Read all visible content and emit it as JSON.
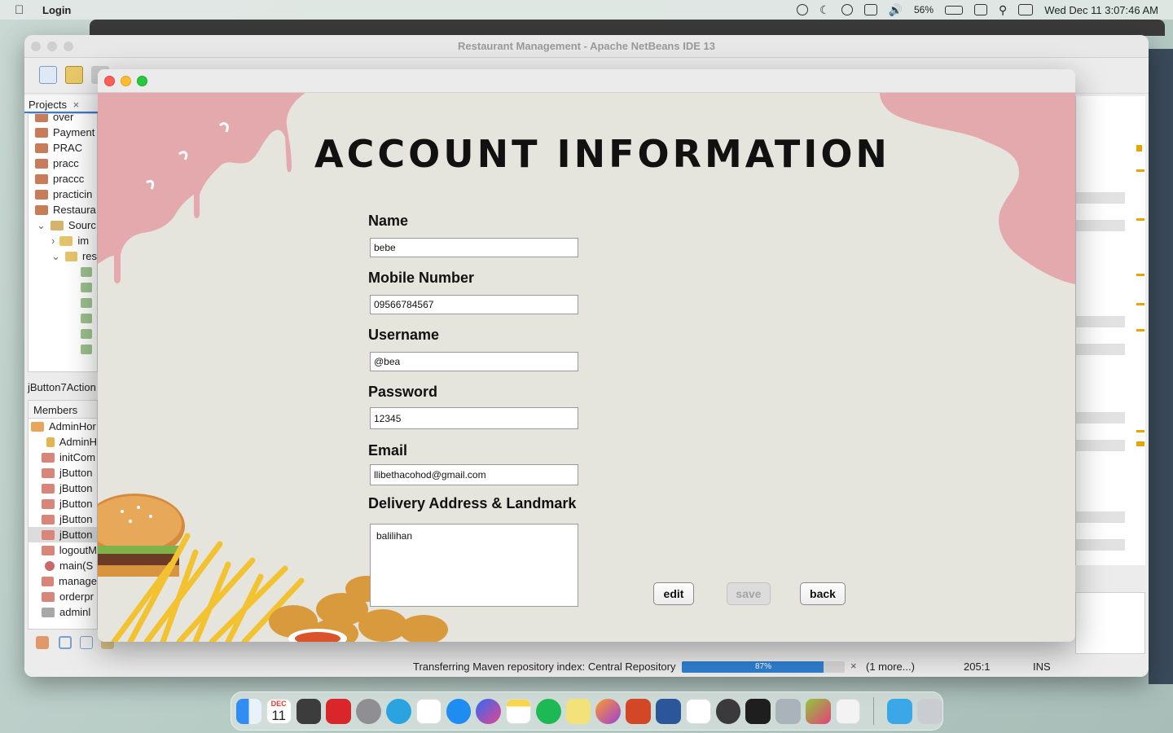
{
  "menubar": {
    "app_name": "Login",
    "battery": "56%",
    "datetime": "Wed Dec 11  3:07:46 AM"
  },
  "ide": {
    "title": "Restaurant Management - Apache NetBeans IDE 13",
    "projects_tab": "Projects",
    "project_items": [
      "over",
      "Payment",
      "PRAC",
      "pracc",
      "praccc",
      "practicin",
      "Restaura",
      "Sourc",
      "im",
      "res"
    ],
    "navigator_title": "jButton7Action",
    "members_header": "Members",
    "member_items": [
      "AdminHor",
      "AdminH",
      "initCom",
      "jButton",
      "jButton",
      "jButton",
      "jButton",
      "jButton",
      "logoutM",
      "main(S",
      "manage",
      "orderpr",
      "adminl"
    ],
    "status": {
      "message": "Transferring Maven repository index: Central Repository",
      "progress_label": "87%",
      "progress_value": 0.87,
      "more": "(1 more...)",
      "position": "205:1",
      "mode": "INS"
    }
  },
  "dialog": {
    "heading": "ACCOUNT INFORMATION",
    "fields": {
      "name_label": "Name",
      "name_value": "bebe",
      "mobile_label": "Mobile Number",
      "mobile_value": "09566784567",
      "username_label": "Username",
      "username_value": "@bea",
      "password_label": "Password",
      "password_value": "12345",
      "email_label": "Email",
      "email_value": "llibethacohod@gmail.com",
      "address_label": "Delivery Address & Landmark",
      "address_value": "balilihan"
    },
    "buttons": {
      "edit": "edit",
      "save": "save",
      "back": "back"
    },
    "colors": {
      "background": "#e6e5dd",
      "accent_pink": "#e0aaae"
    }
  },
  "dock": {
    "calendar_month": "DEC",
    "calendar_day": "11",
    "apps": [
      "finder",
      "calendar",
      "calculator",
      "photo-booth",
      "system-settings",
      "telegram",
      "reminders",
      "safari",
      "messenger",
      "notes",
      "spotify",
      "stickies",
      "firefox",
      "powerpoint",
      "word",
      "capcut",
      "quicktime",
      "terminal",
      "settings",
      "netbeans",
      "java",
      "downloads",
      "trash"
    ]
  }
}
